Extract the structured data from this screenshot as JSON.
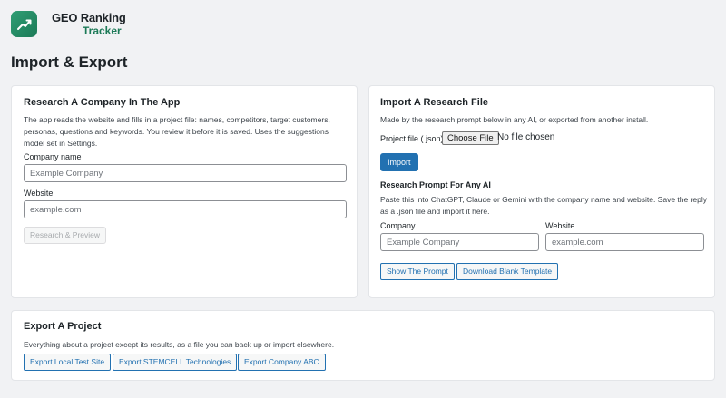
{
  "brand": {
    "line1": "GEO Ranking",
    "line2": "Tracker"
  },
  "page_title": "Import & Export",
  "research_card": {
    "title": "Research A Company In The App",
    "description": "The app reads the website and fills in a project file: names, competitors, target customers, personas, questions and keywords. You review it before it is saved. Uses the suggestions model set in Settings.",
    "company_label": "Company name",
    "company_placeholder": "Example Company",
    "website_label": "Website",
    "website_placeholder": "example.com",
    "research_button": "Research & Preview"
  },
  "import_card": {
    "title": "Import A Research File",
    "description": "Made by the research prompt below in any AI, or exported from another install.",
    "file_label": "Project file (.json)",
    "file_button": "Choose File",
    "file_status": "No file chosen",
    "import_button": "Import",
    "prompt_title": "Research Prompt For Any AI",
    "prompt_description": "Paste this into ChatGPT, Claude or Gemini with the company name and website. Save the reply as a .json file and import it here.",
    "company_label": "Company",
    "company_placeholder": "Example Company",
    "website_label": "Website",
    "website_placeholder": "example.com",
    "show_prompt_button": "Show The Prompt",
    "download_template_button": "Download Blank Template"
  },
  "export_card": {
    "title": "Export A Project",
    "description": "Everything about a project except its results, as a file you can back up or import elsewhere.",
    "buttons": [
      "Export Local Test Site",
      "Export STEMCELL Technologies",
      "Export Company ABC"
    ]
  },
  "colors": {
    "accent": "#2271b1",
    "brand_green": "#1c7a57",
    "background": "#f1f2f4"
  },
  "icons": {
    "logo": "trend-chart-icon"
  }
}
